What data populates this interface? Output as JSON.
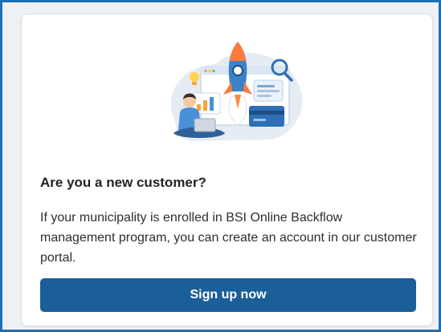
{
  "card": {
    "illustration_icon": "rocket-launch-illustration-icon",
    "title": "Are you a new customer?",
    "description": "If your municipality is enrolled in BSI Online Backflow management program, you can create an account in our customer portal.",
    "button_label": "Sign up now"
  },
  "colors": {
    "frame_border": "#1e6fb3",
    "button_bg": "#1a5f98",
    "button_text": "#ffffff",
    "title_text": "#1f2328",
    "body_text": "#2b2f33"
  }
}
